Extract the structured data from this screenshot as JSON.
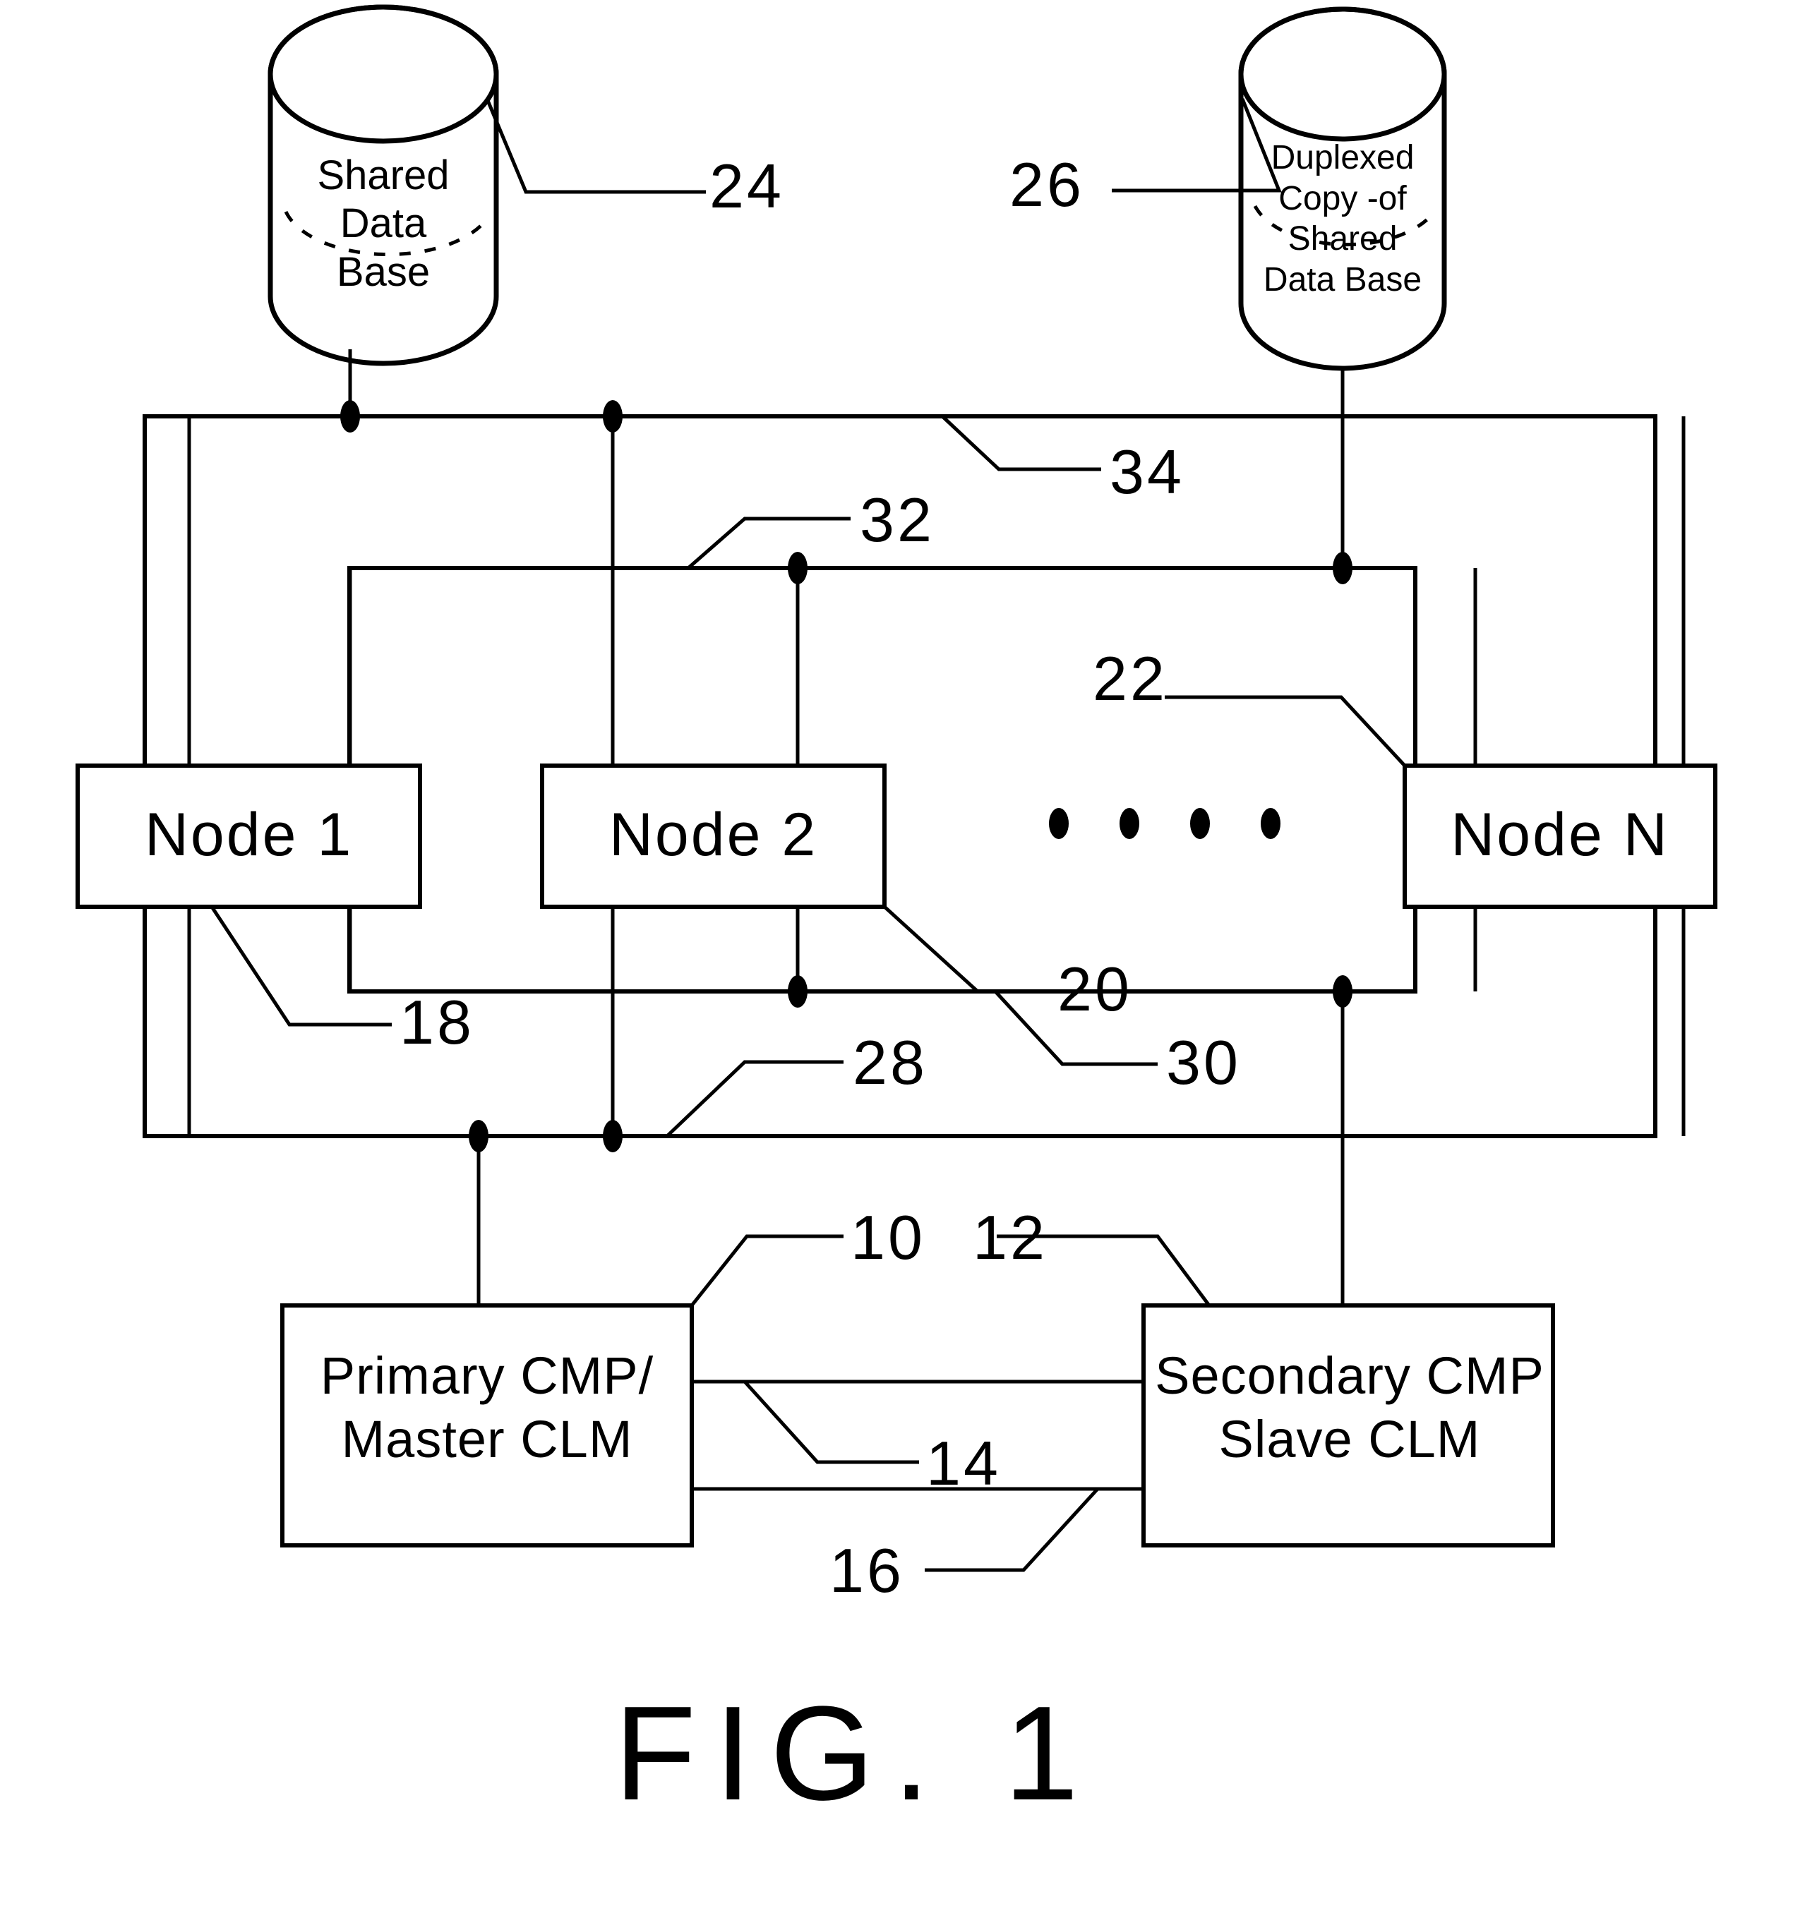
{
  "figure": {
    "caption": "FIG. 1",
    "title": "FIG. 1"
  },
  "databases": [
    {
      "ref": "24",
      "name": "shared-data-base",
      "lines": [
        "Shared",
        "Data",
        "Base"
      ],
      "full_text": "Shared Data Base"
    },
    {
      "ref": "26",
      "name": "duplexed-copy-data-base",
      "lines": [
        "Duplexed",
        "Copy -of",
        "Shared",
        "Data Base"
      ],
      "full_text": "Duplexed Copy -of Shared Data Base"
    }
  ],
  "nodes": [
    {
      "ref": "18",
      "label": "Node 1"
    },
    {
      "ref": "20",
      "label": "Node 2"
    },
    {
      "ref": "22",
      "label": "Node N"
    }
  ],
  "node_ellipsis": "• • • •",
  "buses": [
    {
      "ref": "34",
      "name": "outer-bus"
    },
    {
      "ref": "32",
      "name": "inner-bus"
    },
    {
      "ref": "28",
      "name": "outer-bus-lower-segment"
    },
    {
      "ref": "30",
      "name": "inner-bus-lower-segment"
    }
  ],
  "processors": [
    {
      "ref": "10",
      "name": "primary-cmp",
      "lines": [
        "Primary CMP/",
        "Master CLM"
      ],
      "full_text": "Primary CMP/ Master CLM"
    },
    {
      "ref": "12",
      "name": "secondary-cmp",
      "lines": [
        "Secondary CMP",
        "Slave CLM"
      ],
      "full_text": "Secondary CMP Slave CLM"
    }
  ],
  "interlinks": [
    {
      "ref": "14",
      "name": "cmp-link-upper"
    },
    {
      "ref": "16",
      "name": "cmp-link-lower"
    }
  ],
  "colors": {
    "ink": "#000000",
    "paper": "#ffffff"
  }
}
